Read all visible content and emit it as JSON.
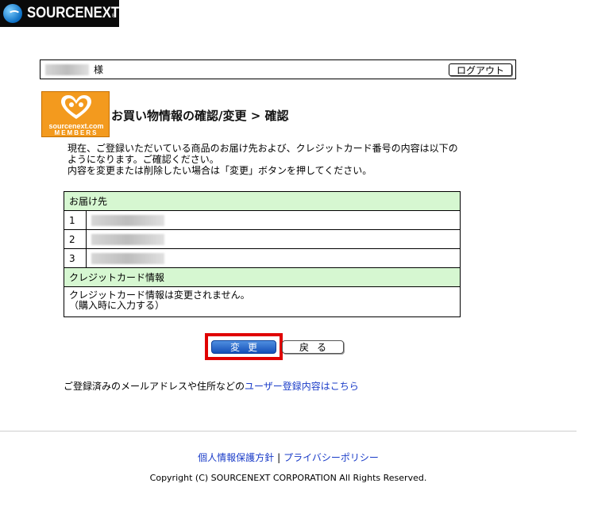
{
  "brand": {
    "name": "SOURCENEXT",
    "reg_mark": "®"
  },
  "userbar": {
    "honorific": "様",
    "logout_label": "ログアウト"
  },
  "members_logo": {
    "line1": "sourcenext.com",
    "line2": "MEMBERS"
  },
  "title": "お買い物情報の確認/変更 > 確認",
  "intro": {
    "line1": "現在、ご登録いただいている商品のお届け先および、クレジットカード番号の内容は以下の",
    "line2": "ようになります。ご確認ください。",
    "line3": "内容を変更または削除したい場合は「変更」ボタンを押してください。"
  },
  "table": {
    "delivery_header": "お届け先",
    "rows": [
      {
        "num": "1"
      },
      {
        "num": "2"
      },
      {
        "num": "3"
      }
    ],
    "card_header": "クレジットカード情報",
    "card_line1": "クレジットカード情報は変更されません。",
    "card_line2": "（購入時に入力する）"
  },
  "buttons": {
    "change": "変更",
    "back": "戻る"
  },
  "registration": {
    "prefix": "ご登録済みのメールアドレスや住所などの",
    "link": "ユーザー登録内容はこちら"
  },
  "footer": {
    "privacy_policy": "個人情報保護方針",
    "separator": "|",
    "privacy_policy_en": "プライバシーポリシー",
    "copyright": "Copyright (C) SOURCENEXT CORPORATION All Rights Reserved."
  },
  "colors": {
    "table_header_bg": "#d6f7d1",
    "link": "#1a3cc8",
    "highlight": "#e00000",
    "members_orange": "#f39a1e"
  }
}
